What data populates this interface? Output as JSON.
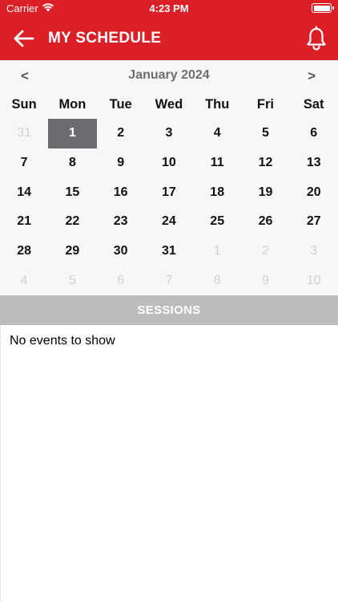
{
  "status_bar": {
    "carrier": "Carrier",
    "time": "4:23 PM"
  },
  "header": {
    "title": "MY SCHEDULE",
    "back_icon": "arrow-left-icon",
    "bell_icon": "bell-icon",
    "accent_color": "#da1f26"
  },
  "calendar": {
    "month_label": "January 2024",
    "prev_label": "<",
    "next_label": ">",
    "weekdays": [
      "Sun",
      "Mon",
      "Tue",
      "Wed",
      "Thu",
      "Fri",
      "Sat"
    ],
    "days": [
      {
        "label": "31",
        "in_month": false
      },
      {
        "label": "1",
        "in_month": true,
        "selected": true
      },
      {
        "label": "2",
        "in_month": true
      },
      {
        "label": "3",
        "in_month": true
      },
      {
        "label": "4",
        "in_month": true
      },
      {
        "label": "5",
        "in_month": true
      },
      {
        "label": "6",
        "in_month": true
      },
      {
        "label": "7",
        "in_month": true
      },
      {
        "label": "8",
        "in_month": true
      },
      {
        "label": "9",
        "in_month": true
      },
      {
        "label": "10",
        "in_month": true
      },
      {
        "label": "11",
        "in_month": true
      },
      {
        "label": "12",
        "in_month": true
      },
      {
        "label": "13",
        "in_month": true
      },
      {
        "label": "14",
        "in_month": true
      },
      {
        "label": "15",
        "in_month": true
      },
      {
        "label": "16",
        "in_month": true
      },
      {
        "label": "17",
        "in_month": true
      },
      {
        "label": "18",
        "in_month": true
      },
      {
        "label": "19",
        "in_month": true
      },
      {
        "label": "20",
        "in_month": true
      },
      {
        "label": "21",
        "in_month": true
      },
      {
        "label": "22",
        "in_month": true
      },
      {
        "label": "23",
        "in_month": true
      },
      {
        "label": "24",
        "in_month": true
      },
      {
        "label": "25",
        "in_month": true
      },
      {
        "label": "26",
        "in_month": true
      },
      {
        "label": "27",
        "in_month": true
      },
      {
        "label": "28",
        "in_month": true
      },
      {
        "label": "29",
        "in_month": true
      },
      {
        "label": "30",
        "in_month": true
      },
      {
        "label": "31",
        "in_month": true
      },
      {
        "label": "1",
        "in_month": false
      },
      {
        "label": "2",
        "in_month": false
      },
      {
        "label": "3",
        "in_month": false
      },
      {
        "label": "4",
        "in_month": false
      },
      {
        "label": "5",
        "in_month": false
      },
      {
        "label": "6",
        "in_month": false
      },
      {
        "label": "7",
        "in_month": false
      },
      {
        "label": "8",
        "in_month": false
      },
      {
        "label": "9",
        "in_month": false
      },
      {
        "label": "10",
        "in_month": false
      }
    ]
  },
  "sessions": {
    "title": "SESSIONS",
    "empty_text": "No events to show"
  }
}
